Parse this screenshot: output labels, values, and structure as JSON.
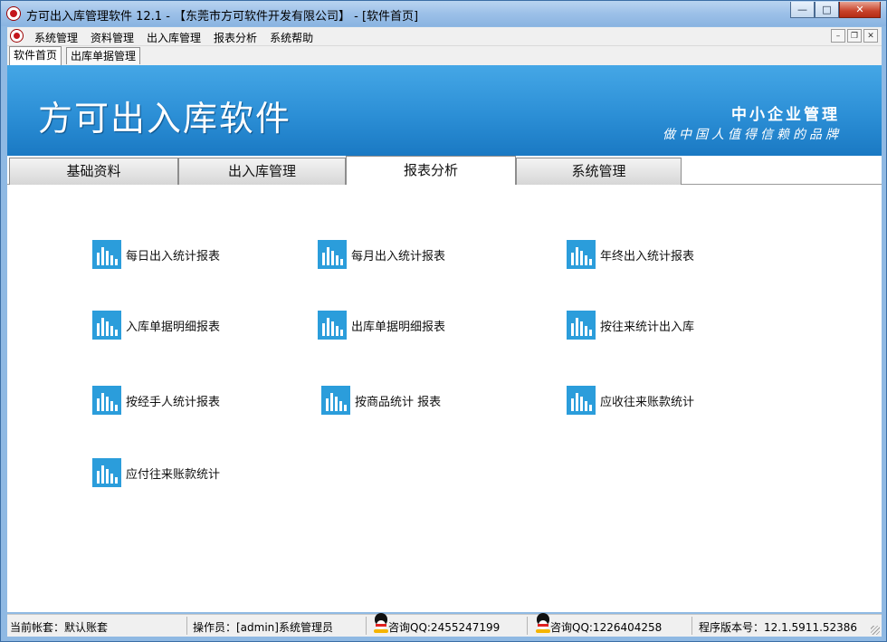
{
  "window": {
    "title": "方可出入库管理软件 12.1 - 【东莞市方可软件开发有限公司】 - [软件首页]",
    "minimize_glyph": "—",
    "maximize_glyph": "□",
    "close_glyph": "✕"
  },
  "menubar": {
    "items": [
      "系统管理",
      "资料管理",
      "出入库管理",
      "报表分析",
      "系统帮助"
    ],
    "mdi_min": "–",
    "mdi_restore": "❐",
    "mdi_close": "✕"
  },
  "doc_tabs": [
    "软件首页",
    "出库单据管理"
  ],
  "banner": {
    "title": "方可出入库软件",
    "subtitle": "中小企业管理",
    "slogan": "做中国人值得信赖的品牌"
  },
  "tabs": [
    "基础资料",
    "出入库管理",
    "报表分析",
    "系统管理"
  ],
  "active_tab": "报表分析",
  "reports": [
    "每日出入统计报表",
    "每月出入统计报表",
    "年终出入统计报表",
    "入库单据明细报表",
    "出库单据明细报表",
    "按往来统计出入库",
    "按经手人统计报表",
    "按商品统计 报表",
    "应收往来账款统计",
    "应付往来账款统计"
  ],
  "statusbar": {
    "account": "当前帐套：默认账套",
    "operator": "操作员：[admin]系统管理员",
    "qq1": "咨询QQ:2455247199",
    "qq2": "咨询QQ:1226404258",
    "version": "程序版本号：12.1.5911.52386"
  },
  "colors": {
    "banner": "#2c8fd6",
    "report_icon": "#2b9ddb",
    "title_bar": "#9cc0e8"
  },
  "icons": {
    "app": "app-logo-icon",
    "report": "bar-chart-icon",
    "qq": "qq-penguin-icon"
  }
}
